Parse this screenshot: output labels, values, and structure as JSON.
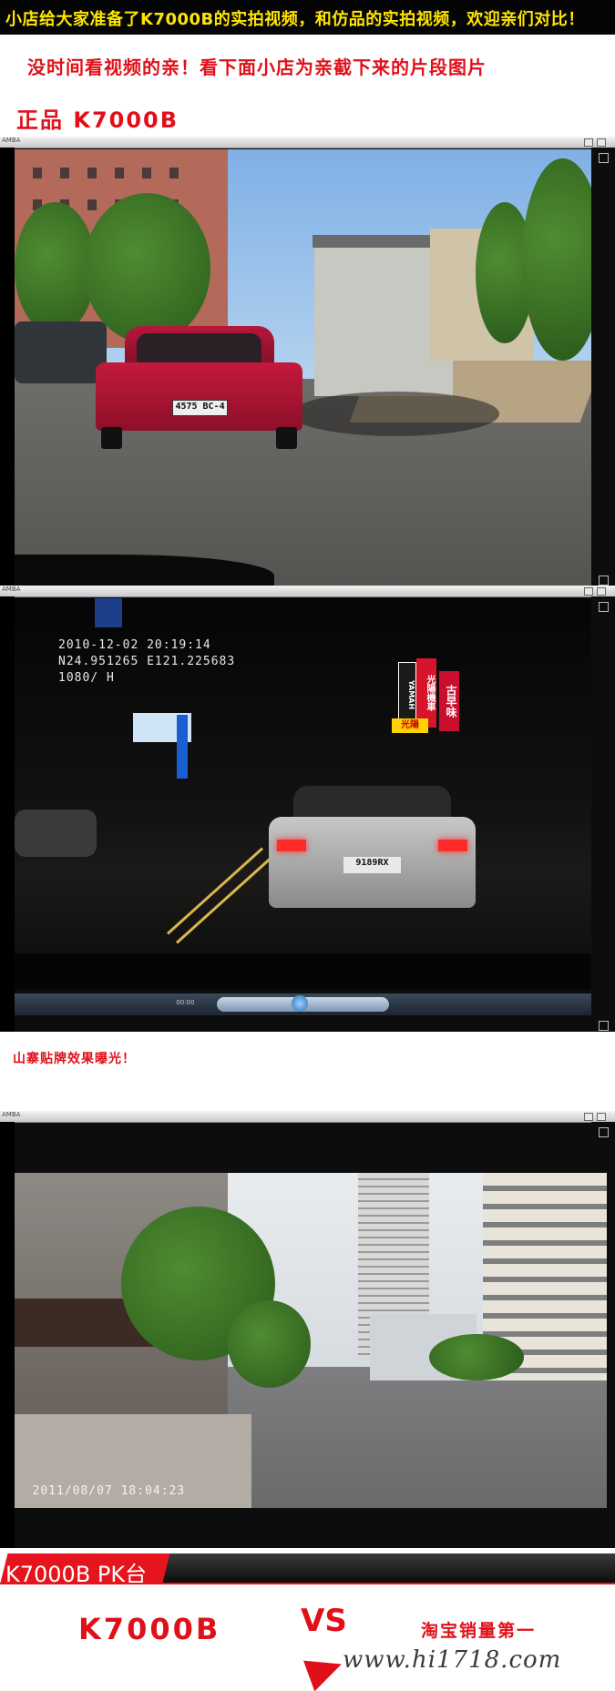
{
  "header": {
    "banner_text": "小店给大家准备了K7000B的实拍视频，和仿品的实拍视频，欢迎亲们对比！",
    "subtitle": "没时间看视频的亲！看下面小店为亲截下来的片段图片",
    "genuine_label": "正品 K7000B"
  },
  "colors": {
    "accent_red": "#e0101a",
    "banner_yellow": "#ffe600",
    "banner_bg": "#050505"
  },
  "players": [
    {
      "app_name": "AMBA",
      "scene": "daytime street, red car",
      "plate": "4575 BC-4"
    },
    {
      "app_name": "AMBA",
      "scene": "night street, silver car",
      "osd_date": "2010-12-02 20:19:14",
      "osd_coords": "N24.951265  E121.225683",
      "osd_res": "1080/ H",
      "plate": "9189RX",
      "signs": [
        "YAMAH",
        "光陽機車",
        "古早味",
        "光陽"
      ],
      "control_time": "00:00"
    },
    {
      "app_name": "AMBA",
      "scene": "street with trees, tower buildings",
      "timestamp": "2011/08/07  18:04:23"
    }
  ],
  "copy_label": "山寨贴牌效果曝光！",
  "pk_bar": {
    "label": "K7000B PK台"
  },
  "bottom": {
    "left_label": "K7000B",
    "vs": "VS",
    "right_label": "淘宝销量第一",
    "site": "www.hi1718.com"
  },
  "icons": [
    "window-close-icon",
    "window-restore-icon",
    "play-icon",
    "stop-icon",
    "prev-icon",
    "next-icon",
    "volume-icon",
    "fullscreen-icon"
  ]
}
